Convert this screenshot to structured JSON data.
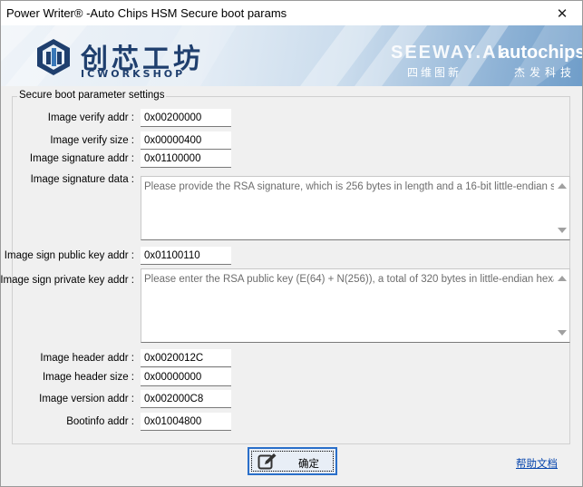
{
  "window": {
    "title": "Power Writer® -Auto Chips HSM Secure boot params",
    "close_label": "✕"
  },
  "banner": {
    "logo_cn": "创芯工坊",
    "logo_en": "ICWORKSHOP",
    "brand1": "SEEWAY.AI",
    "brand1_cn": "四维图新",
    "brand2": "autochips",
    "brand2_cn": "杰发科技"
  },
  "group": {
    "title": "Secure boot parameter settings"
  },
  "fields": {
    "image_verify_addr": {
      "label": "Image verify addr :",
      "value": "0x00200000"
    },
    "image_verify_size": {
      "label": "Image verify size :",
      "value": "0x00000400"
    },
    "image_signature_addr": {
      "label": "Image signature addr :",
      "value": "0x01100000"
    },
    "image_signature_data": {
      "label": "Image signature data :",
      "placeholder": "Please provide the RSA signature, which is 256 bytes in length and a 16-bit little-endian string"
    },
    "image_sign_public_key_addr": {
      "label": "Image sign public key addr :",
      "value": "0x01100110"
    },
    "image_sign_private_key_addr": {
      "label": "Image sign private key addr :",
      "placeholder": "Please enter the RSA public key (E(64) + N(256)), a total of 320 bytes in little-endian hexadec"
    },
    "image_header_addr": {
      "label": "Image header addr :",
      "value": "0x0020012C"
    },
    "image_header_size": {
      "label": "Image header size :",
      "value": "0x00000000"
    },
    "image_version_addr": {
      "label": "Image version addr :",
      "value": "0x002000C8"
    },
    "bootinfo_addr": {
      "label": "Bootinfo addr :",
      "value": "0x01004800"
    }
  },
  "footer": {
    "ok_label": "确定",
    "ok_icon": "edit-icon",
    "help_label": "帮助文档"
  }
}
